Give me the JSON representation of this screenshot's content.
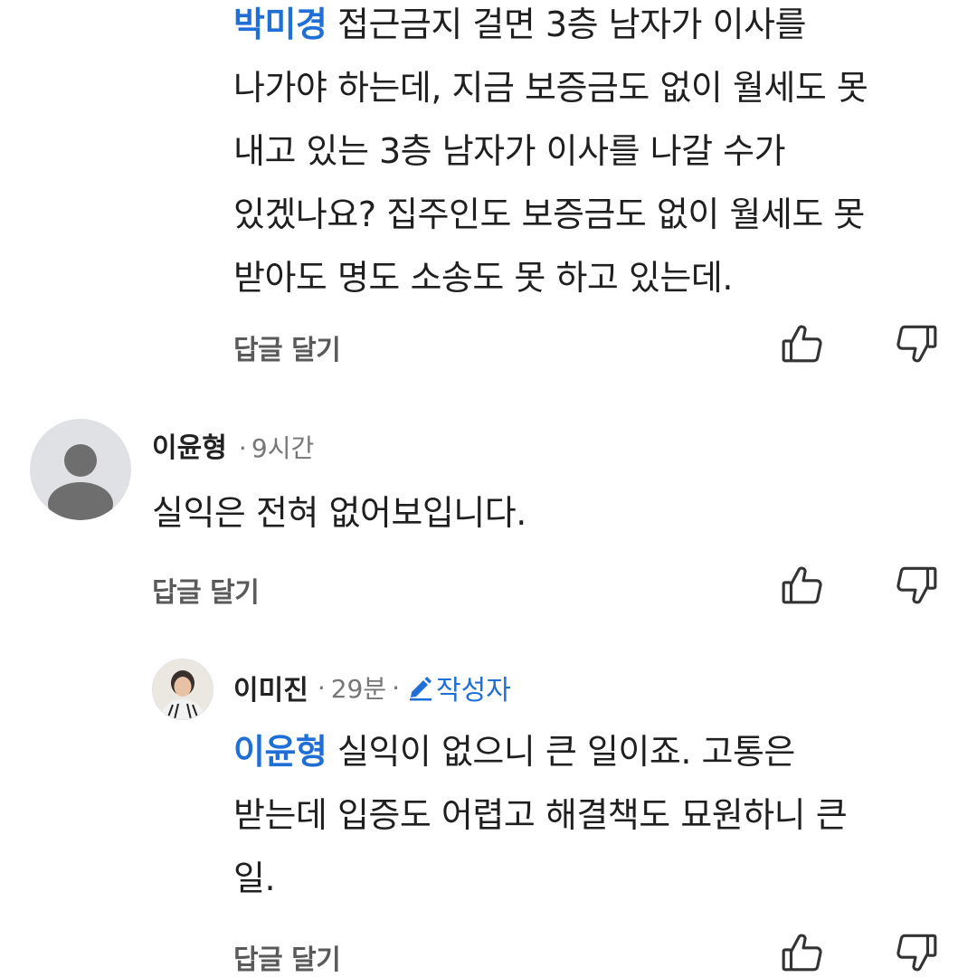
{
  "reply_label": "답글 달기",
  "comments": [
    {
      "mention": "박미경",
      "lines": [
        "접근금지 걸면 3층 남자가 이사를",
        "나가야 하는데, 지금 보증금도 없이 월세도 못",
        "내고 있는 3층 남자가 이사를 나갈 수가",
        "있겠나요? 집주인도 보증금도 없이 월세도 못",
        "받아도 명도 소송도 못 하고 있는데."
      ]
    },
    {
      "author": "이윤형",
      "time": "9시간",
      "separator": "·",
      "text": "실익은 전혀 없어보입니다."
    },
    {
      "author": "이미진",
      "time": "29분",
      "separator": "·",
      "badge": "작성자",
      "mention": "이윤형",
      "lines": [
        "실익이 없으니 큰 일이죠. 고통은",
        "받는데 입증도 어렵고 해결책도 묘원하니 큰",
        "일."
      ]
    }
  ],
  "icons": {
    "like": "thumbs-up-outline",
    "dislike": "thumbs-down-outline",
    "author_badge": "pencil-icon"
  },
  "colors": {
    "mention": "#1f6fd6",
    "badge": "#1f6fd6",
    "text": "#1f1f1f",
    "muted": "#777777"
  }
}
